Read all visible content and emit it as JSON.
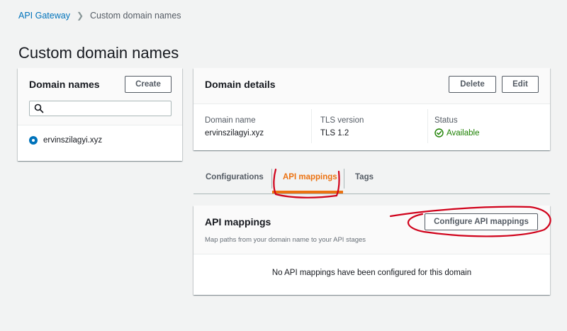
{
  "breadcrumb": {
    "root": "API Gateway",
    "current": "Custom domain names"
  },
  "page": {
    "title": "Custom domain names"
  },
  "domains_panel": {
    "title": "Domain names",
    "create_label": "Create",
    "search_value": "",
    "items": [
      {
        "name": "ervinszilagyi.xyz",
        "selected": true
      }
    ]
  },
  "details": {
    "title": "Domain details",
    "delete_label": "Delete",
    "edit_label": "Edit",
    "fields": {
      "domain_name_label": "Domain name",
      "domain_name_value": "ervinszilagyi.xyz",
      "tls_label": "TLS version",
      "tls_value": "TLS 1.2",
      "status_label": "Status",
      "status_value": "Available"
    }
  },
  "tabs": [
    {
      "label": "Configurations",
      "active": false
    },
    {
      "label": "API mappings",
      "active": true
    },
    {
      "label": "Tags",
      "active": false
    }
  ],
  "mappings": {
    "title": "API mappings",
    "configure_label": "Configure API mappings",
    "description": "Map paths from your domain name to your API stages",
    "empty_text": "No API mappings have been configured for this domain"
  },
  "colors": {
    "link": "#0073bb",
    "active_tab": "#ec7211",
    "success": "#1d8102",
    "annotation": "#d0021b"
  }
}
